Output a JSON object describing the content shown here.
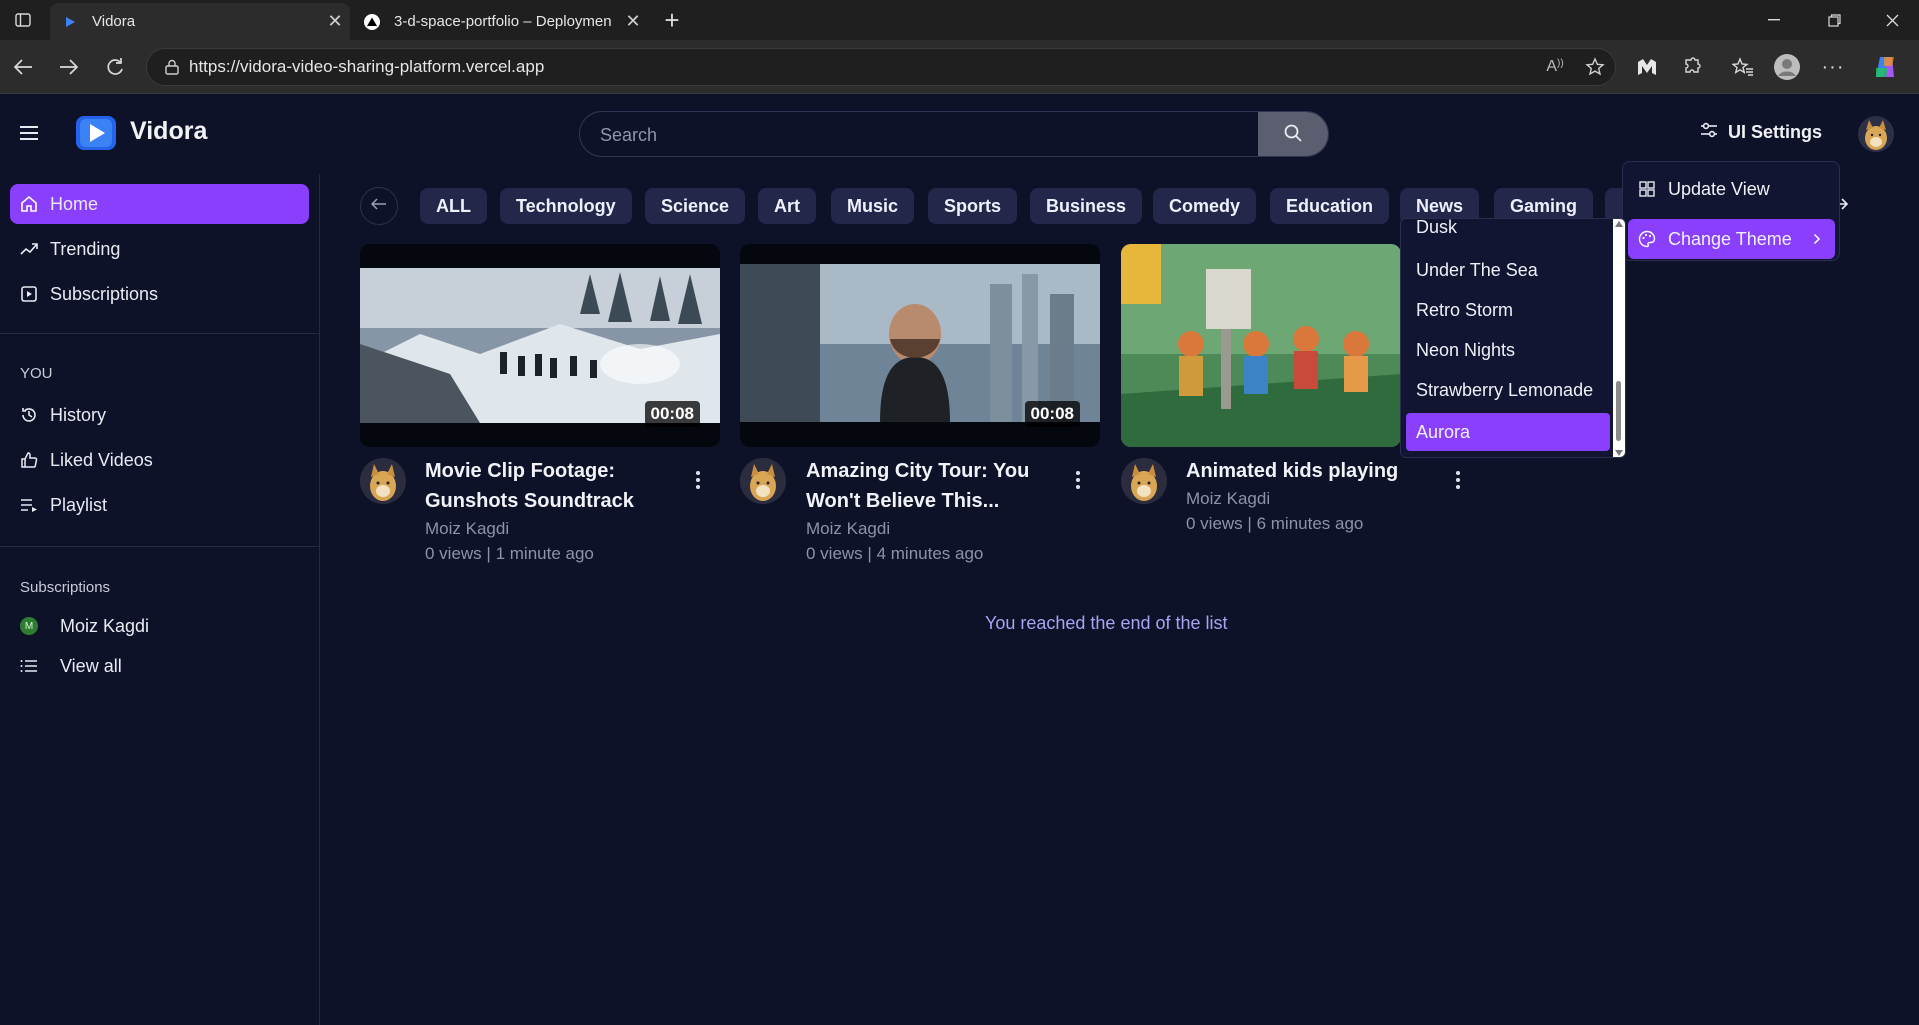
{
  "browser": {
    "tabs": [
      {
        "title": "Vidora",
        "close": "✕"
      },
      {
        "title": "3-d-space-portfolio – Deploymen",
        "close": "✕"
      }
    ],
    "new_tab": "+",
    "url": "https://vidora-video-sharing-platform.vercel.app"
  },
  "header": {
    "logo_text": "Vidora",
    "search_placeholder": "Search",
    "ui_settings_label": "UI Settings"
  },
  "sidebar": {
    "primary": [
      {
        "label": "Home",
        "icon": "home-icon",
        "active": true
      },
      {
        "label": "Trending",
        "icon": "trending-icon"
      },
      {
        "label": "Subscriptions",
        "icon": "subscriptions-icon"
      }
    ],
    "you_heading": "YOU",
    "you_items": [
      {
        "label": "History",
        "icon": "history-icon"
      },
      {
        "label": "Liked Videos",
        "icon": "thumbs-up-icon"
      },
      {
        "label": "Playlist",
        "icon": "playlist-icon"
      }
    ],
    "subs_heading": "Subscriptions",
    "subs": [
      {
        "label": "Moiz Kagdi",
        "initial": "M"
      },
      {
        "label": "View all",
        "icon": "list-icon"
      }
    ]
  },
  "chips": [
    "ALL",
    "Technology",
    "Science",
    "Art",
    "Music",
    "Sports",
    "Business",
    "Comedy",
    "Education",
    "News",
    "Gaming"
  ],
  "videos": [
    {
      "title_line1": "Movie Clip Footage:",
      "title_line2": "Gunshots Soundtrack",
      "channel": "Moiz Kagdi",
      "views": "0 views",
      "age": "1 minute ago",
      "duration": "00:08"
    },
    {
      "title_line1": "Amazing City Tour: You",
      "title_line2": "Won't Believe This...",
      "channel": "Moiz Kagdi",
      "views": "0 views",
      "age": "4 minutes ago",
      "duration": "00:08"
    },
    {
      "title_line1": "Animated kids playing",
      "title_line2": "",
      "channel": "Moiz Kagdi",
      "views": "0 views",
      "age": "6 minutes ago",
      "duration": ""
    }
  ],
  "meta_separator": "|",
  "end_message": "You reached the end of the list",
  "settings_menu": {
    "items": [
      {
        "label": "Update View",
        "icon": "grid-icon"
      },
      {
        "label": "Change Theme",
        "icon": "palette-icon",
        "active": true
      }
    ]
  },
  "theme_menu": {
    "options": [
      "Dusk",
      "Under The Sea",
      "Retro Storm",
      "Neon Nights",
      "Strawberry Lemonade",
      "Aurora"
    ],
    "selected": "Aurora"
  },
  "colors": {
    "background": "#0e1229",
    "accent": "#8a3ffc",
    "chip": "#23274a",
    "muted_text": "#8e92a8",
    "end_text": "#a7a4f0"
  }
}
